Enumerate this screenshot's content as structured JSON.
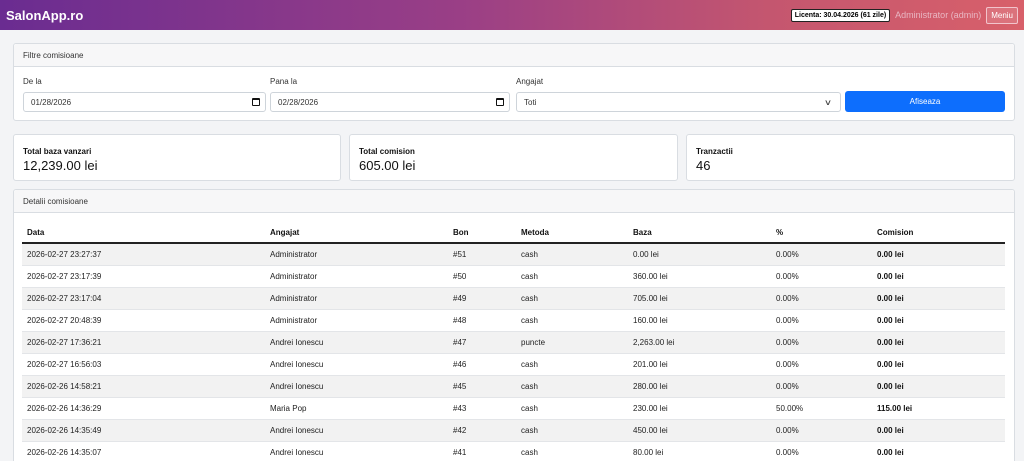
{
  "header": {
    "brand": "SalonApp.ro",
    "license": "Licenta: 30.04.2026 (61 zile)",
    "user": "Administrator (admin)",
    "menu_label": "Meniu"
  },
  "filters": {
    "title": "Filtre comisioane",
    "from_label": "De la",
    "from_value": "01/28/2026",
    "to_label": "Pana la",
    "to_value": "02/28/2026",
    "employee_label": "Angajat",
    "employee_value": "Toti",
    "show_label": "Afiseaza"
  },
  "stats": {
    "base_label": "Total baza vanzari",
    "base_value": "12,239.00 lei",
    "commission_label": "Total comision",
    "commission_value": "605.00 lei",
    "transactions_label": "Tranzactii",
    "transactions_value": "46"
  },
  "details": {
    "title": "Detalii comisioane",
    "columns": [
      "Data",
      "Angajat",
      "Bon",
      "Metoda",
      "Baza",
      "%",
      "Comision"
    ],
    "rows": [
      [
        "2026-02-27 23:27:37",
        "Administrator",
        "#51",
        "cash",
        "0.00 lei",
        "0.00%",
        "0.00 lei"
      ],
      [
        "2026-02-27 23:17:39",
        "Administrator",
        "#50",
        "cash",
        "360.00 lei",
        "0.00%",
        "0.00 lei"
      ],
      [
        "2026-02-27 23:17:04",
        "Administrator",
        "#49",
        "cash",
        "705.00 lei",
        "0.00%",
        "0.00 lei"
      ],
      [
        "2026-02-27 20:48:39",
        "Administrator",
        "#48",
        "cash",
        "160.00 lei",
        "0.00%",
        "0.00 lei"
      ],
      [
        "2026-02-27 17:36:21",
        "Andrei Ionescu",
        "#47",
        "puncte",
        "2,263.00 lei",
        "0.00%",
        "0.00 lei"
      ],
      [
        "2026-02-27 16:56:03",
        "Andrei Ionescu",
        "#46",
        "cash",
        "201.00 lei",
        "0.00%",
        "0.00 lei"
      ],
      [
        "2026-02-26 14:58:21",
        "Andrei Ionescu",
        "#45",
        "cash",
        "280.00 lei",
        "0.00%",
        "0.00 lei"
      ],
      [
        "2026-02-26 14:36:29",
        "Maria Pop",
        "#43",
        "cash",
        "230.00 lei",
        "50.00%",
        "115.00 lei"
      ],
      [
        "2026-02-26 14:35:49",
        "Andrei Ionescu",
        "#42",
        "cash",
        "450.00 lei",
        "0.00%",
        "0.00 lei"
      ],
      [
        "2026-02-26 14:35:07",
        "Andrei Ionescu",
        "#41",
        "cash",
        "80.00 lei",
        "0.00%",
        "0.00 lei"
      ]
    ]
  }
}
